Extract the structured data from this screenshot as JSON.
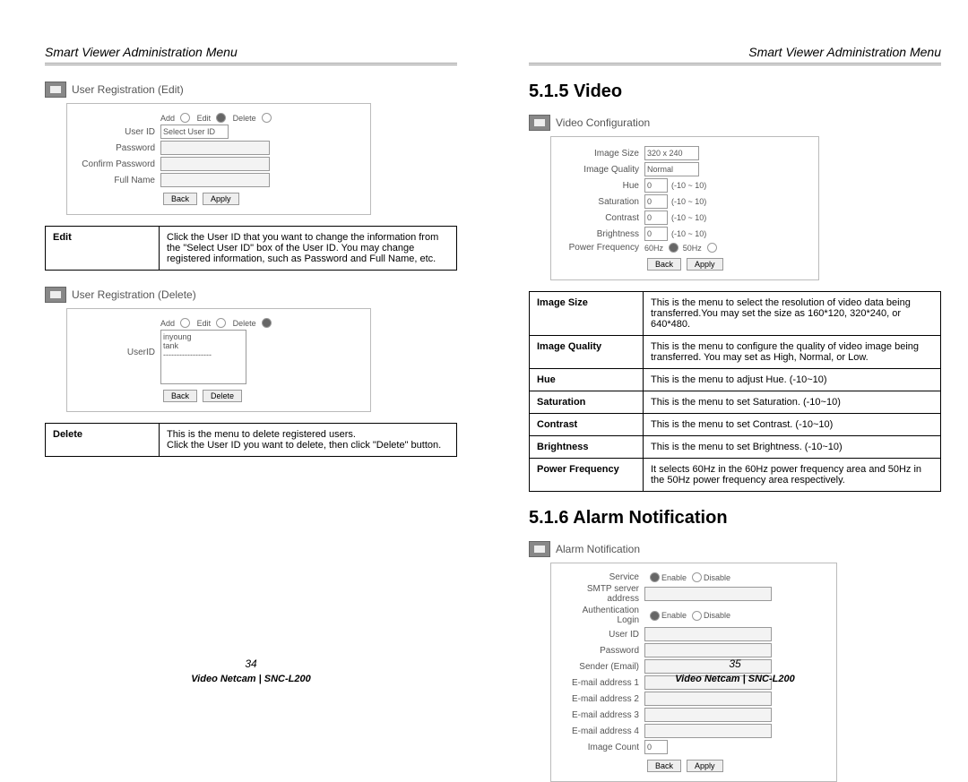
{
  "header": "Smart Viewer Administration Menu",
  "left": {
    "panel_edit": {
      "title": "User Registration (Edit)",
      "add_label": "Add",
      "edit_label": "Edit",
      "delete_label": "Delete",
      "userid_label": "User ID",
      "userid_value": "Select User ID",
      "password_label": "Password",
      "confirm_label": "Confirm Password",
      "fullname_label": "Full Name",
      "back_btn": "Back",
      "apply_btn": "Apply"
    },
    "desc_edit": {
      "key": "Edit",
      "text": "Click the User ID that you want to change the information from the \"Select User ID\" box of the User ID. You may change registered information, such as Password and Full Name, etc."
    },
    "panel_delete": {
      "title": "User Registration (Delete)",
      "add_label": "Add",
      "edit_label": "Edit",
      "delete_label": "Delete",
      "userid_label": "UserID",
      "list_item1": "inyoung",
      "list_item2": "tank",
      "list_item3": "------------------",
      "back_btn": "Back",
      "delete_btn": "Delete"
    },
    "desc_delete": {
      "key": "Delete",
      "text": "This is the menu to delete registered users.\nClick the User ID you want to delete, then click \"Delete\" button."
    },
    "page_number": "34",
    "product": "Video Netcam | SNC-L200"
  },
  "right": {
    "section_video": "5.1.5 Video",
    "panel_video": {
      "title": "Video Configuration",
      "image_size_label": "Image Size",
      "image_size_value": "320 x 240",
      "image_quality_label": "Image Quality",
      "image_quality_value": "Normal",
      "hue_label": "Hue",
      "hue_value": "0",
      "hue_range": "(-10 ~ 10)",
      "saturation_label": "Saturation",
      "saturation_value": "0",
      "saturation_range": "(-10 ~ 10)",
      "contrast_label": "Contrast",
      "contrast_value": "0",
      "contrast_range": "(-10 ~ 10)",
      "brightness_label": "Brightness",
      "brightness_value": "0",
      "brightness_range": "(-10 ~ 10)",
      "powerfreq_label": "Power Frequency",
      "powerfreq_60": "60Hz",
      "powerfreq_50": "50Hz",
      "back_btn": "Back",
      "apply_btn": "Apply"
    },
    "table_video": [
      {
        "key": "Image Size",
        "text": "This is the menu to select the resolution of video data being transferred.You may set the size as 160*120, 320*240, or 640*480."
      },
      {
        "key": "Image Quality",
        "text": "This is the menu to configure the quality of video image being transferred. You may set as High, Normal, or Low."
      },
      {
        "key": "Hue",
        "text": "This is the menu to adjust Hue. (-10~10)"
      },
      {
        "key": "Saturation",
        "text": "This is the menu to set Saturation. (-10~10)"
      },
      {
        "key": "Contrast",
        "text": "This is the menu to set Contrast. (-10~10)"
      },
      {
        "key": "Brightness",
        "text": "This is the menu to set Brightness. (-10~10)"
      },
      {
        "key": "Power Frequency",
        "text": "It selects 60Hz in the 60Hz power frequency area and 50Hz in the 50Hz power frequency area respectively."
      }
    ],
    "section_alarm": "5.1.6 Alarm Notification",
    "panel_alarm": {
      "title": "Alarm Notification",
      "service_label": "Service",
      "enable": "Enable",
      "disable": "Disable",
      "smtp_label": "SMTP server address",
      "auth_label": "Authentication Login",
      "userid_label": "User ID",
      "password_label": "Password",
      "sender_label": "Sender (Email)",
      "email1_label": "E-mail address 1",
      "email2_label": "E-mail address 2",
      "email3_label": "E-mail address 3",
      "email4_label": "E-mail address 4",
      "image_count_label": "Image Count",
      "image_count_value": "0",
      "back_btn": "Back",
      "apply_btn": "Apply"
    },
    "page_number": "35",
    "product": "Video Netcam | SNC-L200"
  }
}
